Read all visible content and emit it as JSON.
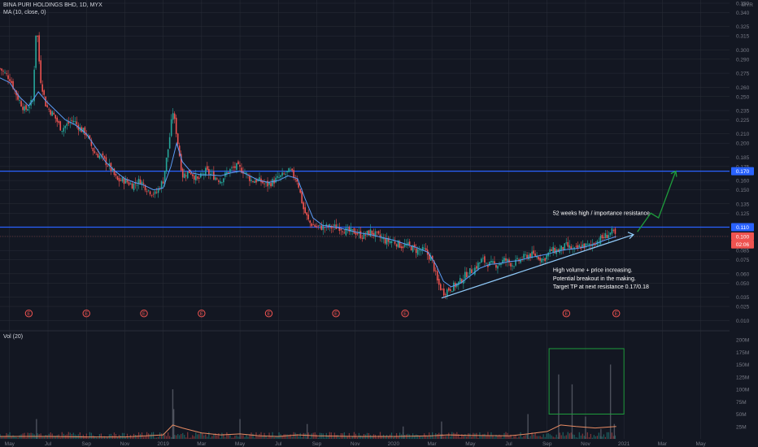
{
  "header": {
    "symbol_line": "BINA PURI HOLDINGS BHD, 1D, MYX",
    "ma_line": "MA (10, close, 0)",
    "vol_line": "Vol (20)",
    "currency": "MYR"
  },
  "chart_data": {
    "type": "candlestick",
    "title": "BINA PURI HOLDINGS BHD, 1D, MYX",
    "indicators": [
      "MA (10, close, 0)",
      "Vol (20)"
    ],
    "price_axis": {
      "ylim": [
        0.005,
        0.35
      ],
      "ticks": [
        "0.350",
        "0.340",
        "0.325",
        "0.315",
        "0.300",
        "0.290",
        "0.275",
        "0.260",
        "0.250",
        "0.235",
        "0.225",
        "0.210",
        "0.200",
        "0.185",
        "0.175",
        "0.160",
        "0.150",
        "0.135",
        "0.125",
        "0.110",
        "0.100",
        "0.085",
        "0.075",
        "0.060",
        "0.050",
        "0.035",
        "0.025",
        "0.010"
      ],
      "tick_values": [
        0.35,
        0.34,
        0.325,
        0.315,
        0.3,
        0.29,
        0.275,
        0.26,
        0.25,
        0.235,
        0.225,
        0.21,
        0.2,
        0.185,
        0.175,
        0.16,
        0.15,
        0.135,
        0.125,
        0.11,
        0.1,
        0.085,
        0.075,
        0.06,
        0.05,
        0.035,
        0.025,
        0.01
      ],
      "price_labels": [
        {
          "text": "0.170",
          "value": 0.17,
          "style": "blue"
        },
        {
          "text": "0.110",
          "value": 0.11,
          "style": "blue"
        },
        {
          "text": "0.100",
          "value": 0.1,
          "style": "red"
        },
        {
          "text": "02:06",
          "value": 0.0915,
          "style": "red"
        }
      ]
    },
    "volume_axis": {
      "ticks": [
        "200M",
        "175M",
        "150M",
        "125M",
        "100M",
        "75M",
        "50M",
        "25M"
      ],
      "tick_values": [
        200,
        175,
        150,
        125,
        100,
        75,
        50,
        25
      ]
    },
    "time_axis": {
      "labels": [
        "May",
        "Jul",
        "Sep",
        "Nov",
        "2019",
        "Mar",
        "May",
        "Jul",
        "Sep",
        "Nov",
        "2020",
        "Mar",
        "May",
        "Jul",
        "Sep",
        "Nov",
        "2021",
        "Mar",
        "May"
      ],
      "t_values": [
        0,
        2,
        4,
        6,
        8,
        10,
        12,
        14,
        16,
        18,
        20,
        22,
        24,
        26,
        28,
        30,
        32,
        34,
        36
      ],
      "range": [
        -0.5,
        37.5
      ]
    },
    "price_path": [
      [
        -0.5,
        0.28
      ],
      [
        0,
        0.27
      ],
      [
        0.4,
        0.25
      ],
      [
        0.8,
        0.235
      ],
      [
        1.2,
        0.245
      ],
      [
        1.4,
        0.33
      ],
      [
        1.6,
        0.27
      ],
      [
        1.9,
        0.24
      ],
      [
        2.3,
        0.23
      ],
      [
        2.7,
        0.215
      ],
      [
        3.0,
        0.22
      ],
      [
        3.3,
        0.225
      ],
      [
        3.7,
        0.215
      ],
      [
        4.0,
        0.21
      ],
      [
        4.4,
        0.19
      ],
      [
        4.8,
        0.185
      ],
      [
        5.2,
        0.175
      ],
      [
        5.6,
        0.16
      ],
      [
        6.0,
        0.16
      ],
      [
        6.4,
        0.155
      ],
      [
        6.8,
        0.16
      ],
      [
        7.2,
        0.15
      ],
      [
        7.6,
        0.145
      ],
      [
        8.0,
        0.16
      ],
      [
        8.3,
        0.2
      ],
      [
        8.5,
        0.235
      ],
      [
        8.7,
        0.21
      ],
      [
        9.0,
        0.165
      ],
      [
        9.4,
        0.17
      ],
      [
        9.8,
        0.16
      ],
      [
        10.2,
        0.17
      ],
      [
        10.6,
        0.165
      ],
      [
        11.0,
        0.16
      ],
      [
        11.4,
        0.17
      ],
      [
        11.8,
        0.175
      ],
      [
        12.2,
        0.17
      ],
      [
        12.6,
        0.16
      ],
      [
        13.0,
        0.16
      ],
      [
        13.4,
        0.155
      ],
      [
        13.8,
        0.16
      ],
      [
        14.2,
        0.165
      ],
      [
        14.6,
        0.17
      ],
      [
        15.0,
        0.16
      ],
      [
        15.3,
        0.13
      ],
      [
        15.6,
        0.115
      ],
      [
        16.0,
        0.11
      ],
      [
        16.4,
        0.11
      ],
      [
        16.8,
        0.11
      ],
      [
        17.2,
        0.11
      ],
      [
        17.6,
        0.105
      ],
      [
        18.0,
        0.105
      ],
      [
        18.4,
        0.1
      ],
      [
        18.8,
        0.105
      ],
      [
        19.2,
        0.1
      ],
      [
        19.6,
        0.095
      ],
      [
        20.0,
        0.095
      ],
      [
        20.4,
        0.09
      ],
      [
        20.8,
        0.09
      ],
      [
        21.2,
        0.085
      ],
      [
        21.6,
        0.085
      ],
      [
        22.0,
        0.075
      ],
      [
        22.3,
        0.05
      ],
      [
        22.6,
        0.04
      ],
      [
        23.0,
        0.045
      ],
      [
        23.4,
        0.05
      ],
      [
        23.8,
        0.06
      ],
      [
        24.2,
        0.065
      ],
      [
        24.6,
        0.075
      ],
      [
        25.0,
        0.07
      ],
      [
        25.4,
        0.07
      ],
      [
        25.8,
        0.075
      ],
      [
        26.2,
        0.07
      ],
      [
        26.6,
        0.075
      ],
      [
        27.0,
        0.08
      ],
      [
        27.4,
        0.08
      ],
      [
        27.8,
        0.075
      ],
      [
        28.2,
        0.085
      ],
      [
        28.6,
        0.085
      ],
      [
        29.0,
        0.09
      ],
      [
        29.4,
        0.085
      ],
      [
        29.8,
        0.09
      ],
      [
        30.2,
        0.09
      ],
      [
        30.6,
        0.095
      ],
      [
        31.0,
        0.1
      ],
      [
        31.4,
        0.105
      ],
      [
        31.6,
        0.1
      ]
    ],
    "ma_path": [
      [
        -0.5,
        0.27
      ],
      [
        0,
        0.265
      ],
      [
        0.5,
        0.25
      ],
      [
        1.0,
        0.24
      ],
      [
        1.5,
        0.255
      ],
      [
        1.9,
        0.245
      ],
      [
        2.4,
        0.235
      ],
      [
        2.9,
        0.225
      ],
      [
        3.4,
        0.22
      ],
      [
        4.0,
        0.21
      ],
      [
        4.5,
        0.195
      ],
      [
        5.0,
        0.18
      ],
      [
        5.5,
        0.17
      ],
      [
        6.0,
        0.162
      ],
      [
        6.5,
        0.158
      ],
      [
        7.0,
        0.155
      ],
      [
        7.5,
        0.15
      ],
      [
        8.0,
        0.152
      ],
      [
        8.4,
        0.175
      ],
      [
        8.7,
        0.2
      ],
      [
        9.0,
        0.18
      ],
      [
        9.5,
        0.168
      ],
      [
        10.0,
        0.166
      ],
      [
        10.5,
        0.166
      ],
      [
        11.0,
        0.165
      ],
      [
        11.5,
        0.168
      ],
      [
        12.0,
        0.17
      ],
      [
        12.5,
        0.165
      ],
      [
        13.0,
        0.16
      ],
      [
        13.5,
        0.158
      ],
      [
        14.0,
        0.16
      ],
      [
        14.5,
        0.165
      ],
      [
        15.0,
        0.162
      ],
      [
        15.4,
        0.14
      ],
      [
        15.8,
        0.12
      ],
      [
        16.3,
        0.112
      ],
      [
        17.0,
        0.11
      ],
      [
        17.6,
        0.107
      ],
      [
        18.2,
        0.104
      ],
      [
        18.8,
        0.102
      ],
      [
        19.4,
        0.099
      ],
      [
        20.0,
        0.096
      ],
      [
        20.6,
        0.092
      ],
      [
        21.2,
        0.088
      ],
      [
        21.8,
        0.083
      ],
      [
        22.2,
        0.07
      ],
      [
        22.6,
        0.052
      ],
      [
        23.0,
        0.046
      ],
      [
        23.5,
        0.05
      ],
      [
        24.0,
        0.058
      ],
      [
        24.5,
        0.066
      ],
      [
        25.0,
        0.07
      ],
      [
        25.5,
        0.071
      ],
      [
        26.0,
        0.073
      ],
      [
        26.5,
        0.074
      ],
      [
        27.0,
        0.077
      ],
      [
        27.5,
        0.079
      ],
      [
        28.0,
        0.081
      ],
      [
        28.5,
        0.084
      ],
      [
        29.0,
        0.086
      ],
      [
        29.5,
        0.087
      ],
      [
        30.0,
        0.089
      ],
      [
        30.5,
        0.092
      ],
      [
        31.0,
        0.096
      ],
      [
        31.6,
        0.1
      ]
    ],
    "volume_bars": [
      {
        "t": 1.4,
        "v": 40
      },
      {
        "t": 8.5,
        "v": 100
      },
      {
        "t": 8.55,
        "v": 60
      },
      {
        "t": 12.0,
        "v": 40
      },
      {
        "t": 15.5,
        "v": 30
      },
      {
        "t": 20.5,
        "v": 25
      },
      {
        "t": 22.5,
        "v": 35
      },
      {
        "t": 27.0,
        "v": 50
      },
      {
        "t": 28.6,
        "v": 130
      },
      {
        "t": 29.3,
        "v": 110
      },
      {
        "t": 30.0,
        "v": 45
      },
      {
        "t": 30.8,
        "v": 20
      },
      {
        "t": 31.3,
        "v": 150
      },
      {
        "t": 31.5,
        "v": 30
      }
    ],
    "volume_ma_path": [
      [
        -0.5,
        5
      ],
      [
        2,
        5
      ],
      [
        4,
        4
      ],
      [
        6,
        4
      ],
      [
        8,
        8
      ],
      [
        8.5,
        28
      ],
      [
        9.0,
        22
      ],
      [
        10,
        12
      ],
      [
        11,
        8
      ],
      [
        12,
        10
      ],
      [
        13,
        6
      ],
      [
        14,
        5
      ],
      [
        15,
        8
      ],
      [
        16,
        6
      ],
      [
        18,
        5
      ],
      [
        20,
        5
      ],
      [
        22,
        6
      ],
      [
        22.8,
        8
      ],
      [
        24,
        7
      ],
      [
        26,
        6
      ],
      [
        27,
        10
      ],
      [
        28,
        15
      ],
      [
        28.7,
        28
      ],
      [
        29.5,
        25
      ],
      [
        30.5,
        22
      ],
      [
        31.6,
        25
      ]
    ],
    "levels": [
      {
        "name": "resistance-0.17",
        "value": 0.17,
        "color": "#2962ff"
      },
      {
        "name": "resistance-0.11",
        "value": 0.11,
        "color": "#2962ff"
      }
    ],
    "trendline": {
      "from": [
        22.5,
        0.034
      ],
      "to": [
        32.5,
        0.102
      ],
      "color": "#90caf9"
    },
    "projection_path": [
      [
        32.7,
        0.105
      ],
      [
        33.4,
        0.125
      ],
      [
        33.8,
        0.12
      ],
      [
        34.7,
        0.17
      ]
    ],
    "volume_box": {
      "t_from": 28.1,
      "t_to": 32.0,
      "v_from": 50,
      "v_to": 182
    },
    "earnings_markers": [
      1.0,
      4.0,
      7.0,
      10.0,
      13.5,
      17.0,
      20.6,
      29.0,
      31.6
    ],
    "annotations": [
      {
        "text": "52 weeks high / importance resistance",
        "t": 28.3,
        "price": 0.123,
        "color": "#ffffff"
      },
      {
        "text": "High volume + price increasing.",
        "t": 28.3,
        "price": 0.062,
        "color": "#ffffff"
      },
      {
        "text": "Potential breakout in the making.",
        "t": 28.3,
        "price": 0.053,
        "color": "#ffffff"
      },
      {
        "text": "Target TP at next resistance 0.17/0.18",
        "t": 28.3,
        "price": 0.044,
        "color": "#ffffff"
      }
    ],
    "colors": {
      "up": "#26a69a",
      "down": "#ef5350",
      "ma": "#5b9cf6",
      "background": "#131722",
      "grid": "#2a2e39",
      "level": "#2962ff",
      "projection": "#1e9c3c",
      "volume_box": "#1e9c3c",
      "volume_ma": "#e88b63"
    }
  }
}
